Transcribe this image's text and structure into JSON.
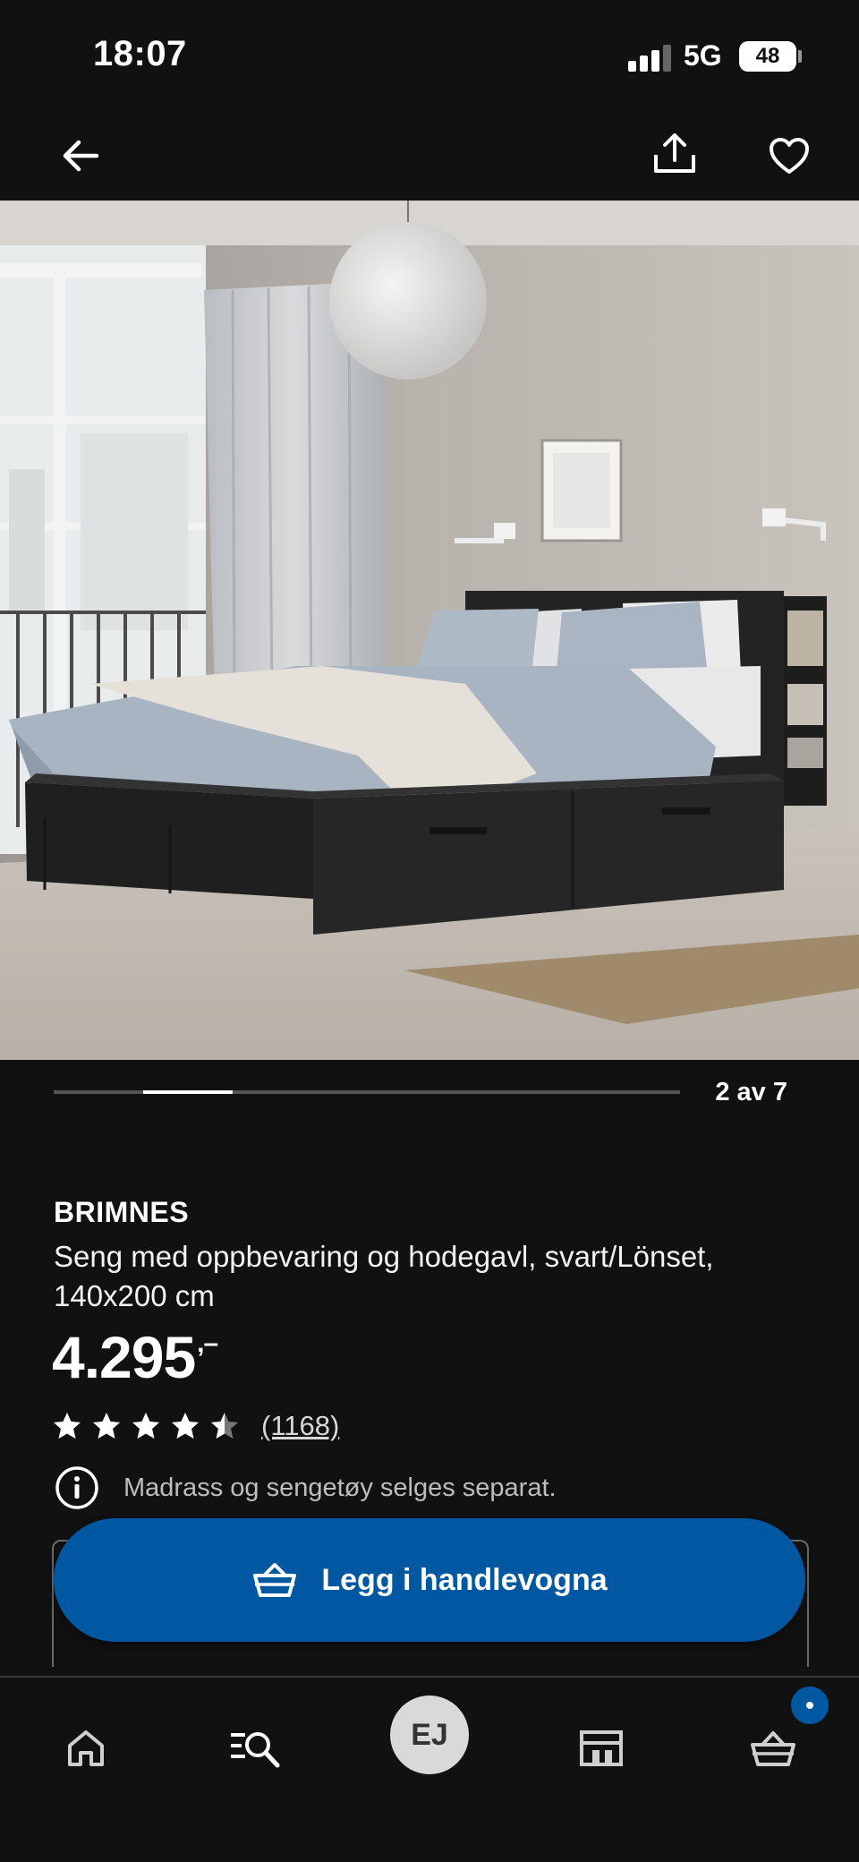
{
  "status_bar": {
    "time": "18:07",
    "network": "5G",
    "battery": "48",
    "signal_icon": "cellular-signal-icon"
  },
  "top_nav": {
    "back_icon": "arrow-left-icon",
    "share_icon": "share-upload-icon",
    "favorite_icon": "heart-outline-icon"
  },
  "gallery": {
    "counter": "2 av 7",
    "current_index": 2,
    "total": 7
  },
  "product": {
    "name": "BRIMNES",
    "description": "Seng med oppbevaring og hodegavl, svart/Lönset, 140x200 cm",
    "price": "4.295",
    "price_suffix": ",–",
    "rating": 4.5,
    "rating_max": 5,
    "review_count": "(1168)",
    "info_text": "Madrass og sengetøy selges separat."
  },
  "cta": {
    "add_to_cart_label": "Legg i handlevogna",
    "icon": "shopping-basket-icon"
  },
  "bottom_nav": {
    "items": [
      {
        "icon": "home-icon"
      },
      {
        "icon": "search-list-icon"
      },
      {
        "label": "EJ",
        "icon": "avatar"
      },
      {
        "icon": "store-icon"
      },
      {
        "icon": "shopping-basket-icon"
      }
    ]
  },
  "colors": {
    "background": "#111111",
    "accent": "#0058A3",
    "text_secondary": "#bdbdbd"
  }
}
